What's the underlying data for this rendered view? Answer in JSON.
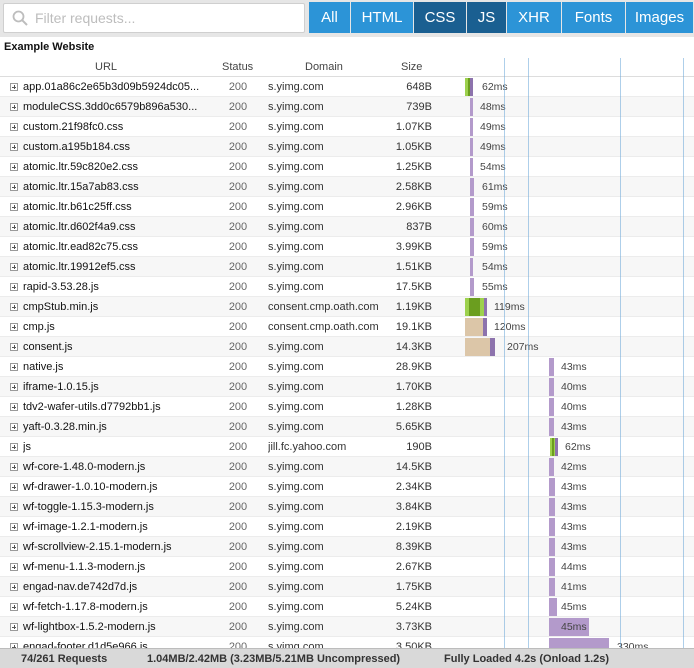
{
  "search": {
    "placeholder": "Filter requests..."
  },
  "filters": [
    {
      "label": "All",
      "active": false
    },
    {
      "label": "HTML",
      "active": false
    },
    {
      "label": "CSS",
      "active": true
    },
    {
      "label": "JS",
      "active": true
    },
    {
      "label": "XHR",
      "active": false
    },
    {
      "label": "Fonts",
      "active": false
    },
    {
      "label": "Images",
      "active": false
    }
  ],
  "page_title": "Example Website",
  "columns": {
    "url": "URL",
    "status": "Status",
    "domain": "Domain",
    "size": "Size"
  },
  "rows": [
    {
      "url": "app.01a86c2e65b3d09b5924dc05...",
      "status": "200",
      "domain": "s.yimg.com",
      "size": "648B",
      "time": "62ms"
    },
    {
      "url": "moduleCSS.3dd0c6579b896a530...",
      "status": "200",
      "domain": "s.yimg.com",
      "size": "739B",
      "time": "48ms"
    },
    {
      "url": "custom.21f98fc0.css",
      "status": "200",
      "domain": "s.yimg.com",
      "size": "1.07KB",
      "time": "49ms"
    },
    {
      "url": "custom.a195b184.css",
      "status": "200",
      "domain": "s.yimg.com",
      "size": "1.05KB",
      "time": "49ms"
    },
    {
      "url": "atomic.ltr.59c820e2.css",
      "status": "200",
      "domain": "s.yimg.com",
      "size": "1.25KB",
      "time": "54ms"
    },
    {
      "url": "atomic.ltr.15a7ab83.css",
      "status": "200",
      "domain": "s.yimg.com",
      "size": "2.58KB",
      "time": "61ms"
    },
    {
      "url": "atomic.ltr.b61c25ff.css",
      "status": "200",
      "domain": "s.yimg.com",
      "size": "2.96KB",
      "time": "59ms"
    },
    {
      "url": "atomic.ltr.d602f4a9.css",
      "status": "200",
      "domain": "s.yimg.com",
      "size": "837B",
      "time": "60ms"
    },
    {
      "url": "atomic.ltr.ead82c75.css",
      "status": "200",
      "domain": "s.yimg.com",
      "size": "3.99KB",
      "time": "59ms"
    },
    {
      "url": "atomic.ltr.19912ef5.css",
      "status": "200",
      "domain": "s.yimg.com",
      "size": "1.51KB",
      "time": "54ms"
    },
    {
      "url": "rapid-3.53.28.js",
      "status": "200",
      "domain": "s.yimg.com",
      "size": "17.5KB",
      "time": "55ms"
    },
    {
      "url": "cmpStub.min.js",
      "status": "200",
      "domain": "consent.cmp.oath.com",
      "size": "1.19KB",
      "time": "119ms"
    },
    {
      "url": "cmp.js",
      "status": "200",
      "domain": "consent.cmp.oath.com",
      "size": "19.1KB",
      "time": "120ms"
    },
    {
      "url": "consent.js",
      "status": "200",
      "domain": "s.yimg.com",
      "size": "14.3KB",
      "time": "207ms"
    },
    {
      "url": "native.js",
      "status": "200",
      "domain": "s.yimg.com",
      "size": "28.9KB",
      "time": "43ms"
    },
    {
      "url": "iframe-1.0.15.js",
      "status": "200",
      "domain": "s.yimg.com",
      "size": "1.70KB",
      "time": "40ms"
    },
    {
      "url": "tdv2-wafer-utils.d7792bb1.js",
      "status": "200",
      "domain": "s.yimg.com",
      "size": "1.28KB",
      "time": "40ms"
    },
    {
      "url": "yaft-0.3.28.min.js",
      "status": "200",
      "domain": "s.yimg.com",
      "size": "5.65KB",
      "time": "43ms"
    },
    {
      "url": "js",
      "status": "200",
      "domain": "jill.fc.yahoo.com",
      "size": "190B",
      "time": "62ms"
    },
    {
      "url": "wf-core-1.48.0-modern.js",
      "status": "200",
      "domain": "s.yimg.com",
      "size": "14.5KB",
      "time": "42ms"
    },
    {
      "url": "wf-drawer-1.0.10-modern.js",
      "status": "200",
      "domain": "s.yimg.com",
      "size": "2.34KB",
      "time": "43ms"
    },
    {
      "url": "wf-toggle-1.15.3-modern.js",
      "status": "200",
      "domain": "s.yimg.com",
      "size": "3.84KB",
      "time": "43ms"
    },
    {
      "url": "wf-image-1.2.1-modern.js",
      "status": "200",
      "domain": "s.yimg.com",
      "size": "2.19KB",
      "time": "43ms"
    },
    {
      "url": "wf-scrollview-2.15.1-modern.js",
      "status": "200",
      "domain": "s.yimg.com",
      "size": "8.39KB",
      "time": "43ms"
    },
    {
      "url": "wf-menu-1.1.3-modern.js",
      "status": "200",
      "domain": "s.yimg.com",
      "size": "2.67KB",
      "time": "44ms"
    },
    {
      "url": "engad-nav.de742d7d.js",
      "status": "200",
      "domain": "s.yimg.com",
      "size": "1.75KB",
      "time": "41ms"
    },
    {
      "url": "wf-fetch-1.17.8-modern.js",
      "status": "200",
      "domain": "s.yimg.com",
      "size": "5.24KB",
      "time": "45ms"
    },
    {
      "url": "wf-lightbox-1.5.2-modern.js",
      "status": "200",
      "domain": "s.yimg.com",
      "size": "3.73KB",
      "time": "45ms"
    },
    {
      "url": "engad-footer.d1d5e966.js",
      "status": "200",
      "domain": "s.yimg.com",
      "size": "3.50KB",
      "time": "330ms"
    }
  ],
  "footer": {
    "requests": "74/261 Requests",
    "transferred": "1.04MB/2.42MB  (3.23MB/5.21MB Uncompressed)",
    "loaded": "Fully Loaded 4.2s  (Onload 1.2s)"
  },
  "colors": {
    "filter_bg": "#2c94d7",
    "filter_active": "#1a5f91",
    "dns": "#dcc6a8",
    "connect": "#9dd14d",
    "ssl": "#6b9e1f",
    "wait": "#b39acb",
    "receive": "#8d73ad"
  }
}
